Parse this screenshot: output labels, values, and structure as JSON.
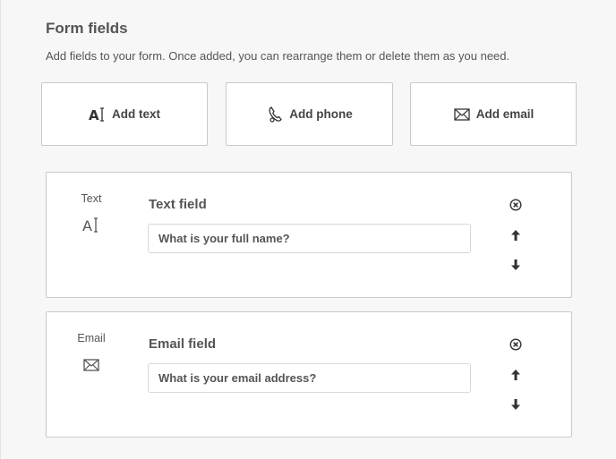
{
  "header": {
    "title": "Form fields",
    "subtitle": "Add fields to your form. Once added, you can rearrange them or delete them as you need."
  },
  "add_buttons": [
    {
      "label": "Add text",
      "icon": "text-cursor-icon"
    },
    {
      "label": "Add phone",
      "icon": "phone-icon"
    },
    {
      "label": "Add email",
      "icon": "envelope-icon"
    }
  ],
  "fields": [
    {
      "type_label": "Text",
      "type_icon": "text-cursor-icon",
      "title": "Text field",
      "placeholder": "What is your full name?"
    },
    {
      "type_label": "Email",
      "type_icon": "envelope-icon",
      "title": "Email field",
      "placeholder": "What is your email address?"
    }
  ],
  "controls": {
    "remove_icon": "close-circle-icon",
    "up_icon": "arrow-up-icon",
    "down_icon": "arrow-down-icon"
  },
  "colors": {
    "background": "#f7f7f7",
    "card": "#ffffff",
    "border": "#c9c9c9",
    "text": "#555555"
  }
}
